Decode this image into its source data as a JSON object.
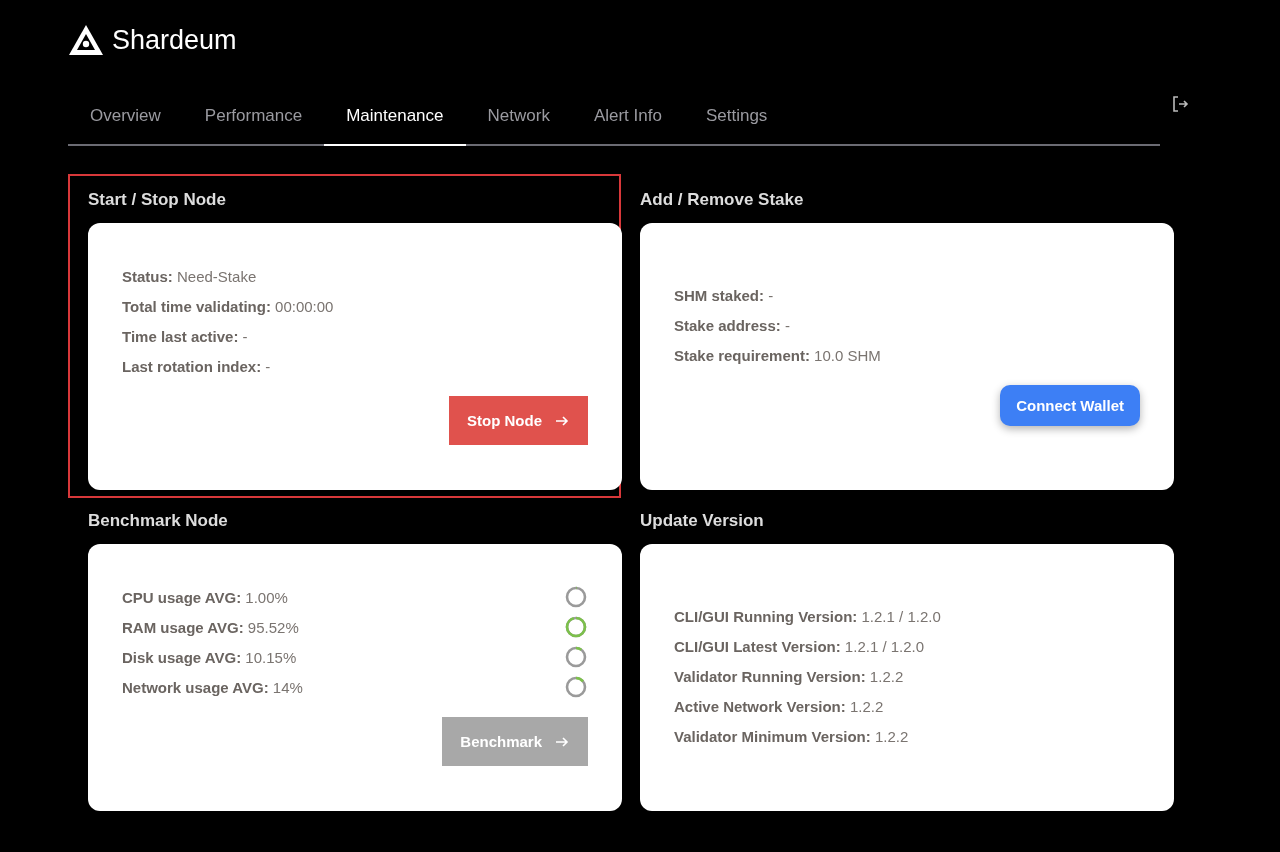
{
  "brand": {
    "name": "Shardeum"
  },
  "tabs": [
    {
      "label": "Overview",
      "selected": false
    },
    {
      "label": "Performance",
      "selected": false
    },
    {
      "label": "Maintenance",
      "selected": true
    },
    {
      "label": "Network",
      "selected": false
    },
    {
      "label": "Alert Info",
      "selected": false
    },
    {
      "label": "Settings",
      "selected": false
    }
  ],
  "sections": [
    {
      "title": "Start / Stop Node",
      "highlighted": true,
      "lines": [
        {
          "text": "**Status:** Need-Stake"
        },
        {
          "text": "**Total time validating:** 00:00:00"
        },
        {
          "text": "**Time last active:** -"
        },
        {
          "text": "**Last rotation index:** -"
        }
      ],
      "button": {
        "label": "Stop Node",
        "kind": "danger",
        "disabled": false
      }
    },
    {
      "title": "Add / Remove Stake",
      "highlighted": false,
      "lines": [
        {
          "text": "**SHM staked:** -"
        },
        {
          "text": "**Stake address:** -"
        },
        {
          "text": "**Stake requirement:** 10.0 SHM"
        }
      ],
      "button": {
        "label": "Connect Wallet",
        "kind": "primary",
        "disabled": false
      }
    },
    {
      "title": "Benchmark Node",
      "highlighted": false,
      "lines": [
        {
          "text": "**CPU usage AVG:** 1.00%",
          "level": 0.01
        },
        {
          "text": "**RAM usage AVG:** 95.52%",
          "level": 0.9552
        },
        {
          "text": "**Disk usage AVG:** 10.15%",
          "level": 0.1015
        },
        {
          "text": "**Network usage AVG:** 14%",
          "level": 0.14
        }
      ],
      "button": {
        "label": "Benchmark",
        "kind": "danger",
        "disabled": true
      }
    },
    {
      "title": "Update Version",
      "highlighted": false,
      "lines": [
        {
          "text": "**CLI/GUI Running Version:** 1.2.1 / 1.2.0"
        },
        {
          "text": "**CLI/GUI Latest Version:** 1.2.1 / 1.2.0"
        },
        {
          "text": "**Validator Running Version:** 1.2.2"
        },
        {
          "text": "**Active Network Version:** 1.2.2"
        },
        {
          "text": "**Validator Minimum Version:** 1.2.2"
        }
      ]
    }
  ]
}
